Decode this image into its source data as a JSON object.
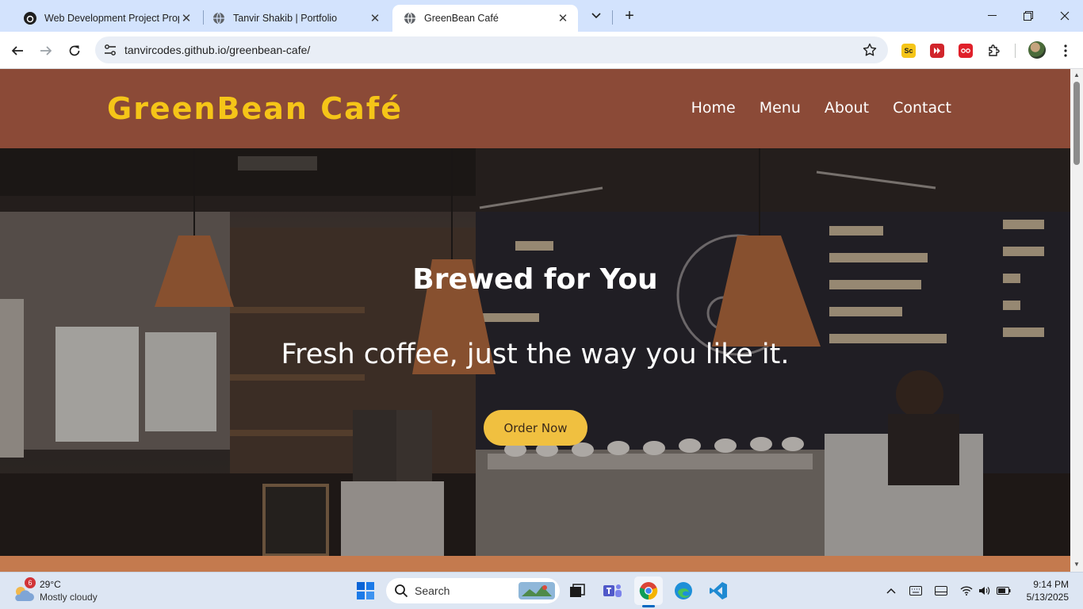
{
  "browser": {
    "tabs": [
      {
        "title": "Web Development Project Prop",
        "favicon": "openai-icon",
        "active": false
      },
      {
        "title": "Tanvir Shakib | Portfolio",
        "favicon": "globe-icon",
        "active": false
      },
      {
        "title": "GreenBean Café",
        "favicon": "globe-icon",
        "active": true
      }
    ],
    "url": "tanvircodes.github.io/greenbean-cafe/",
    "extensions": [
      {
        "name": "sc-extension-icon",
        "label": "Sc",
        "color": "#f5c518"
      },
      {
        "name": "skip-extension-icon",
        "label": "",
        "color": "#d1252b"
      },
      {
        "name": "rec-extension-icon",
        "label": "",
        "color": "#e0202a"
      }
    ]
  },
  "site": {
    "logo": "GreenBean Café",
    "nav": [
      "Home",
      "Menu",
      "About",
      "Contact"
    ],
    "colors": {
      "header": "#8b4a37",
      "logo": "#f5c518",
      "button": "#f0c040",
      "strip": "#c47a4e"
    }
  },
  "hero": {
    "title": "Brewed for You",
    "subtitle": "Fresh coffee, just the way you like it.",
    "cta": "Order Now"
  },
  "taskbar": {
    "weather": {
      "badge": "6",
      "temp": "29°C",
      "desc": "Mostly cloudy"
    },
    "search_placeholder": "Search",
    "time": "9:14 PM",
    "date": "5/13/2025"
  }
}
